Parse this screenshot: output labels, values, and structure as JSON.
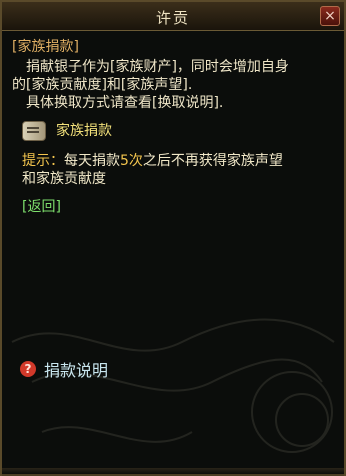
{
  "window": {
    "title": "许贡",
    "close_label": "×"
  },
  "content": {
    "header_tag": "[家族捐款]",
    "desc_line1": "捐献银子作为[家族财产]，同时会增加自身",
    "desc_line2": "的[家族贡献度]和[家族声望].",
    "desc_line3": "具体换取方式请查看[换取说明]."
  },
  "action": {
    "label": "家族捐款",
    "icon": "scroll-icon"
  },
  "hint": {
    "label": "提示：",
    "before_count": "每天捐款",
    "count": "5次",
    "after_count": "之后不再获得家族声望",
    "line2": "和家族贡献度"
  },
  "return_link": "[返回]",
  "help": {
    "icon_glyph": "?",
    "label": "捐款说明"
  },
  "colors": {
    "header": "#e0b064",
    "action": "#f2e07a",
    "return": "#7ee06d",
    "help": "#c9e6ef"
  }
}
